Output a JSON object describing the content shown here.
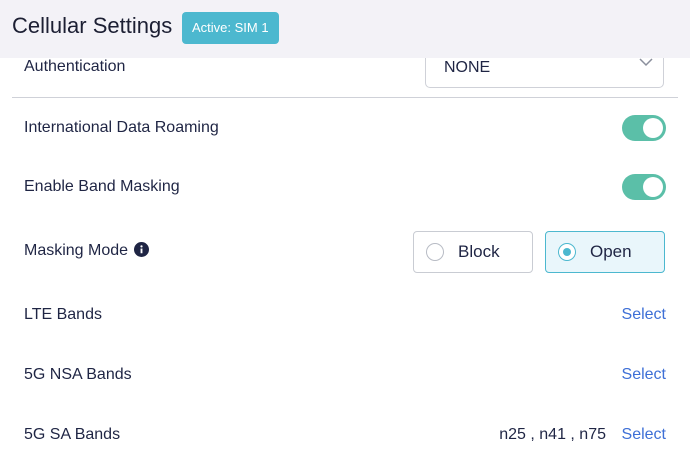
{
  "header": {
    "title": "Cellular Settings",
    "badge": "Active: SIM 1"
  },
  "authentication": {
    "label": "Authentication",
    "value": "NONE",
    "chevron_icon": "chevron-down-icon"
  },
  "international_roaming": {
    "label": "International Data Roaming",
    "enabled": true
  },
  "band_masking": {
    "label": "Enable Band Masking",
    "enabled": true
  },
  "masking_mode": {
    "label": "Masking Mode",
    "info_icon": "info-icon",
    "options": [
      {
        "label": "Block",
        "selected": false
      },
      {
        "label": "Open",
        "selected": true
      }
    ]
  },
  "bands": [
    {
      "label": "LTE Bands",
      "values": "",
      "action": "Select"
    },
    {
      "label": "5G NSA Bands",
      "values": "",
      "action": "Select"
    },
    {
      "label": "5G SA Bands",
      "values": "n25 , n41 , n75",
      "action": "Select"
    }
  ],
  "colors": {
    "accent": "#4cb8cf",
    "toggle_on": "#5bbfa8",
    "link": "#3d6fd6",
    "header_bg": "#f3f2f7"
  }
}
